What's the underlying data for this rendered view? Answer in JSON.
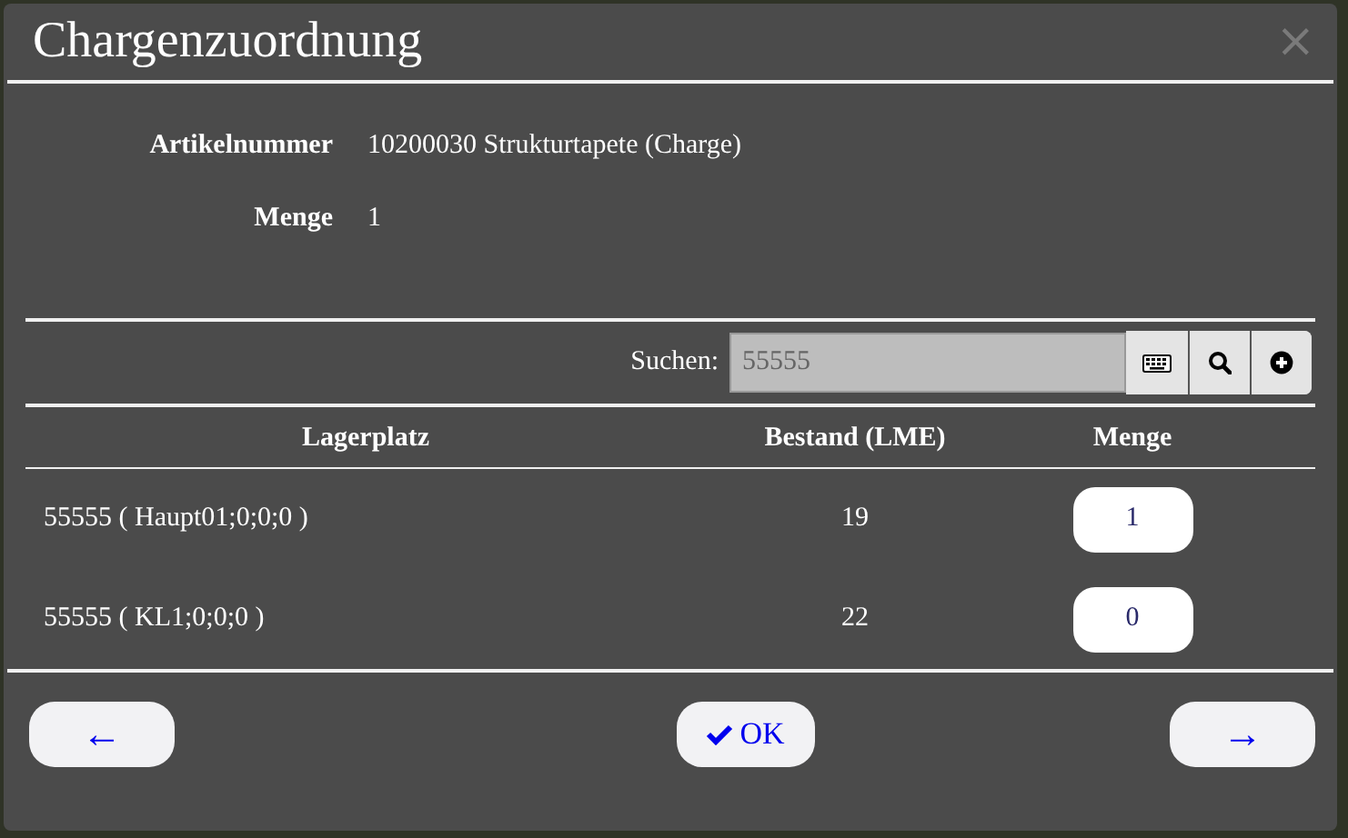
{
  "dialog": {
    "title": "Chargenzuordnung",
    "close": "×"
  },
  "info": [
    {
      "label": "Artikelnummer",
      "value": "10200030 Strukturtapete (Charge)"
    },
    {
      "label": "Menge",
      "value": "1"
    }
  ],
  "search": {
    "label": "Suchen:",
    "value": "55555"
  },
  "table": {
    "columns": [
      "Lagerplatz",
      "Bestand (LME)",
      "Menge"
    ],
    "rows": [
      {
        "lagerplatz": "55555 ( Haupt01;0;0;0 )",
        "bestand": "19",
        "menge": "1"
      },
      {
        "lagerplatz": "55555 ( KL1;0;0;0 )",
        "bestand": "22",
        "menge": "0"
      }
    ]
  },
  "buttons": [
    {
      "kind": "back",
      "label": "←"
    },
    {
      "kind": "ok",
      "label": "OK"
    },
    {
      "kind": "next",
      "label": "→"
    }
  ]
}
